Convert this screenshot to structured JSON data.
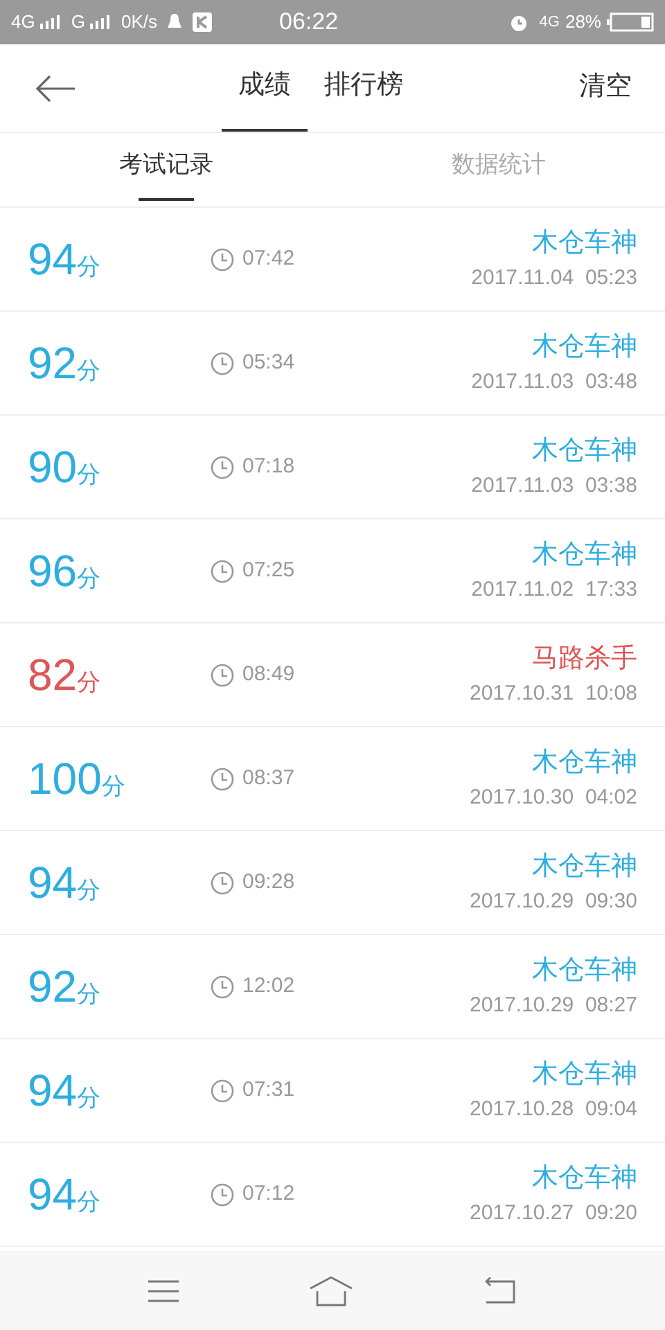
{
  "status_bar": {
    "network_1": "4G",
    "network_2": "G",
    "speed": "0K/s",
    "time": "06:22",
    "network_3": "4G",
    "battery": "28%"
  },
  "header": {
    "tabs": [
      {
        "label": "成绩",
        "selected": true
      },
      {
        "label": "排行榜",
        "selected": false
      }
    ],
    "action": "清空"
  },
  "sub_tabs": [
    {
      "label": "考试记录",
      "selected": true
    },
    {
      "label": "数据统计",
      "selected": false
    }
  ],
  "records": [
    {
      "score": "94",
      "unit": "分",
      "duration": "07:42",
      "title": "木仓车神",
      "date": "2017.11.04  05:23",
      "passed": true
    },
    {
      "score": "92",
      "unit": "分",
      "duration": "05:34",
      "title": "木仓车神",
      "date": "2017.11.03  03:48",
      "passed": true
    },
    {
      "score": "90",
      "unit": "分",
      "duration": "07:18",
      "title": "木仓车神",
      "date": "2017.11.03  03:38",
      "passed": true
    },
    {
      "score": "96",
      "unit": "分",
      "duration": "07:25",
      "title": "木仓车神",
      "date": "2017.11.02  17:33",
      "passed": true
    },
    {
      "score": "82",
      "unit": "分",
      "duration": "08:49",
      "title": "马路杀手",
      "date": "2017.10.31  10:08",
      "passed": false
    },
    {
      "score": "100",
      "unit": "分",
      "duration": "08:37",
      "title": "木仓车神",
      "date": "2017.10.30  04:02",
      "passed": true
    },
    {
      "score": "94",
      "unit": "分",
      "duration": "09:28",
      "title": "木仓车神",
      "date": "2017.10.29  09:30",
      "passed": true
    },
    {
      "score": "92",
      "unit": "分",
      "duration": "12:02",
      "title": "木仓车神",
      "date": "2017.10.29  08:27",
      "passed": true
    },
    {
      "score": "94",
      "unit": "分",
      "duration": "07:31",
      "title": "木仓车神",
      "date": "2017.10.28  09:04",
      "passed": true
    },
    {
      "score": "94",
      "unit": "分",
      "duration": "07:12",
      "title": "木仓车神",
      "date": "2017.10.27  09:20",
      "passed": true
    }
  ]
}
